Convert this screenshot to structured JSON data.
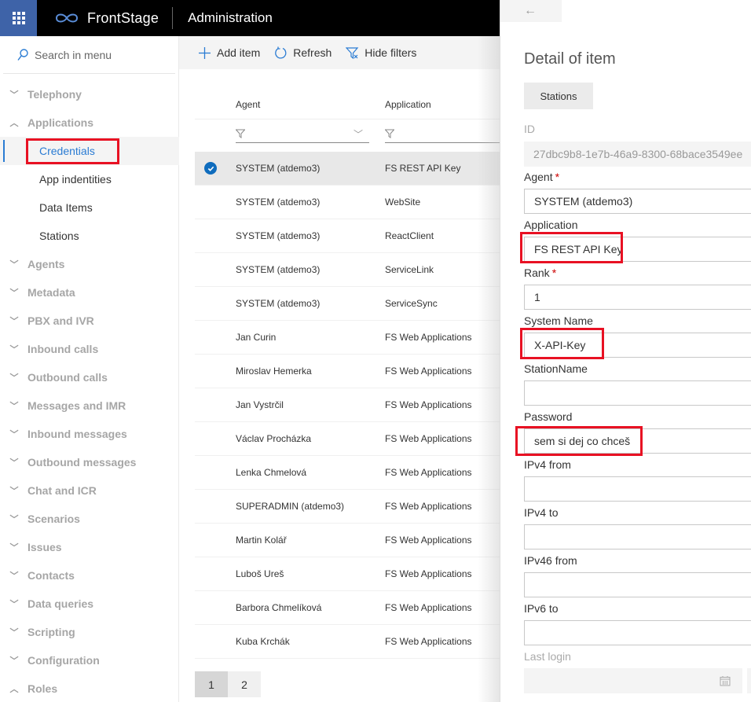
{
  "header": {
    "brand": "FrontStage",
    "app_title": "Administration",
    "accent": "#3e63a8"
  },
  "sidebar": {
    "search_placeholder": "Search in menu",
    "groups": [
      {
        "label": "Telephony",
        "expanded": false
      },
      {
        "label": "Applications",
        "expanded": true,
        "children": [
          {
            "label": "Credentials",
            "active": true
          },
          {
            "label": "App indentities"
          },
          {
            "label": "Data Items"
          },
          {
            "label": "Stations"
          }
        ]
      },
      {
        "label": "Agents",
        "expanded": false
      },
      {
        "label": "Metadata",
        "expanded": false
      },
      {
        "label": "PBX and IVR",
        "expanded": false
      },
      {
        "label": "Inbound calls",
        "expanded": false
      },
      {
        "label": "Outbound calls",
        "expanded": false
      },
      {
        "label": "Messages and IMR",
        "expanded": false
      },
      {
        "label": "Inbound messages",
        "expanded": false
      },
      {
        "label": "Outbound messages",
        "expanded": false
      },
      {
        "label": "Chat and ICR",
        "expanded": false
      },
      {
        "label": "Scenarios",
        "expanded": false
      },
      {
        "label": "Issues",
        "expanded": false
      },
      {
        "label": "Contacts",
        "expanded": false
      },
      {
        "label": "Data queries",
        "expanded": false
      },
      {
        "label": "Scripting",
        "expanded": false
      },
      {
        "label": "Configuration",
        "expanded": false
      },
      {
        "label": "Roles",
        "expanded": true
      }
    ]
  },
  "toolbar": {
    "add_label": "Add item",
    "refresh_label": "Refresh",
    "hide_filters_label": "Hide filters"
  },
  "grid": {
    "columns": [
      "Agent",
      "Application"
    ],
    "rows": [
      {
        "agent": "SYSTEM (atdemo3)",
        "application": "FS REST API Key",
        "selected": true
      },
      {
        "agent": "SYSTEM (atdemo3)",
        "application": "WebSite"
      },
      {
        "agent": "SYSTEM (atdemo3)",
        "application": "ReactClient"
      },
      {
        "agent": "SYSTEM (atdemo3)",
        "application": "ServiceLink"
      },
      {
        "agent": "SYSTEM (atdemo3)",
        "application": "ServiceSync"
      },
      {
        "agent": "Jan Curin",
        "application": "FS Web Applications"
      },
      {
        "agent": "Miroslav Hemerka",
        "application": "FS Web Applications"
      },
      {
        "agent": "Jan Vystrčil",
        "application": "FS Web Applications"
      },
      {
        "agent": "Václav Procházka",
        "application": "FS Web Applications"
      },
      {
        "agent": "Lenka Chmelová",
        "application": "FS Web Applications"
      },
      {
        "agent": "SUPERADMIN (atdemo3)",
        "application": "FS Web Applications"
      },
      {
        "agent": "Martin Kolář",
        "application": "FS Web Applications"
      },
      {
        "agent": "Luboš Ureš",
        "application": "FS Web Applications"
      },
      {
        "agent": "Barbora Chmelíková",
        "application": "FS Web Applications"
      },
      {
        "agent": "Kuba Krchák",
        "application": "FS Web Applications"
      }
    ],
    "pages": [
      "1",
      "2"
    ],
    "current_page": "1"
  },
  "detail": {
    "back_icon": "←",
    "title": "Detail of item",
    "stations_button": "Stations",
    "fields": {
      "id": {
        "label": "ID",
        "value": "27dbc9b8-1e7b-46a9-8300-68bace3549ee"
      },
      "agent": {
        "label": "Agent",
        "required": "*",
        "value": "SYSTEM (atdemo3)"
      },
      "application": {
        "label": "Application",
        "value": "FS REST API Key"
      },
      "rank": {
        "label": "Rank",
        "required": "*",
        "value": "1"
      },
      "system_name": {
        "label": "System Name",
        "value": "X-API-Key"
      },
      "station_name": {
        "label": "StationName",
        "value": ""
      },
      "password": {
        "label": "Password",
        "value": "sem si dej co chceš"
      },
      "ipv4_from": {
        "label": "IPv4 from",
        "value": ""
      },
      "ipv4_to": {
        "label": "IPv4 to",
        "value": ""
      },
      "ipv46_from": {
        "label": "IPv46 from",
        "value": ""
      },
      "ipv6_to": {
        "label": "IPv6 to",
        "value": ""
      },
      "last_login": {
        "label": "Last login",
        "value": ""
      }
    }
  }
}
